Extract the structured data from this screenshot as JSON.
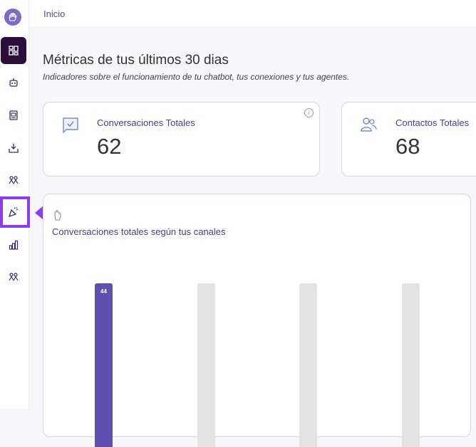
{
  "header": {
    "breadcrumb": "Inicio"
  },
  "page": {
    "title": "Métricas de tus últimos 30 dias",
    "subtitle": "Indicadores sobre el funcionamiento de tu chatbot, tus conexiones y tus agentes."
  },
  "metrics": [
    {
      "label": "Conversaciones Totales",
      "value": "62",
      "icon": "chat-check-icon"
    },
    {
      "label": "Contactos Totales",
      "value": "68",
      "icon": "users-icon"
    }
  ],
  "sidebar": {
    "items": [
      {
        "name": "dashboard",
        "icon": "dashboard-icon",
        "active": true
      },
      {
        "name": "chatbot",
        "icon": "robot-icon"
      },
      {
        "name": "conversations",
        "icon": "document-chat-icon"
      },
      {
        "name": "inbox",
        "icon": "inbox-icon"
      },
      {
        "name": "contacts",
        "icon": "team-icon"
      },
      {
        "name": "campaigns",
        "icon": "party-popper-icon",
        "highlighted": true
      },
      {
        "name": "reports",
        "icon": "bar-chart-icon"
      },
      {
        "name": "agents",
        "icon": "team-icon"
      }
    ]
  },
  "colors": {
    "accent": "#5e4fb0",
    "sidebar_active": "#2a0e3b",
    "highlight": "#8b3cf0",
    "bar_empty": "#e3e3e3"
  },
  "chart_data": {
    "type": "bar",
    "title": "Conversaciones totales según tus canales",
    "categories": [
      "",
      "",
      "",
      ""
    ],
    "values": [
      44,
      null,
      null,
      null
    ],
    "data_labels": [
      "44",
      "",
      "",
      ""
    ]
  }
}
